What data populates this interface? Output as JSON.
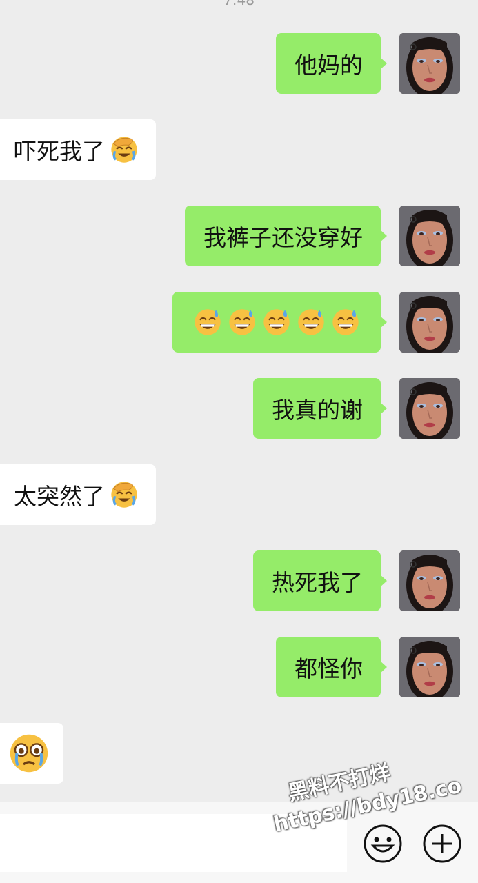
{
  "chat": {
    "top_time_fragment": "7:48",
    "messages": [
      {
        "side": "out",
        "text": "他妈的",
        "emoji": null
      },
      {
        "side": "in",
        "text": "吓死我了",
        "emoji": "face-palm-laugh-emoji"
      },
      {
        "side": "out",
        "text": "我裤子还没穿好",
        "emoji": null
      },
      {
        "side": "out",
        "text": "",
        "emoji": "grin-sweat-emoji",
        "emoji_count": 5
      },
      {
        "side": "out",
        "text": "我真的谢",
        "emoji": null
      },
      {
        "side": "in",
        "text": "太突然了",
        "emoji": "face-palm-laugh-emoji"
      },
      {
        "side": "out",
        "text": "热死我了",
        "emoji": null
      },
      {
        "side": "out",
        "text": "都怪你",
        "emoji": null
      },
      {
        "side": "in",
        "text": "",
        "emoji": "teary-eyes-emoji"
      }
    ]
  },
  "composer": {
    "input_value": "",
    "emoji_button_icon": "smiley-face-icon",
    "more_button_icon": "plus-circle-icon"
  },
  "watermark": {
    "line1": "黑料不打烊",
    "line2": "https://bdy18.co"
  },
  "colors": {
    "background": "#ededed",
    "outgoing_bubble": "#95ec69",
    "incoming_bubble": "#ffffff",
    "composer_bar": "#f7f7f7"
  }
}
